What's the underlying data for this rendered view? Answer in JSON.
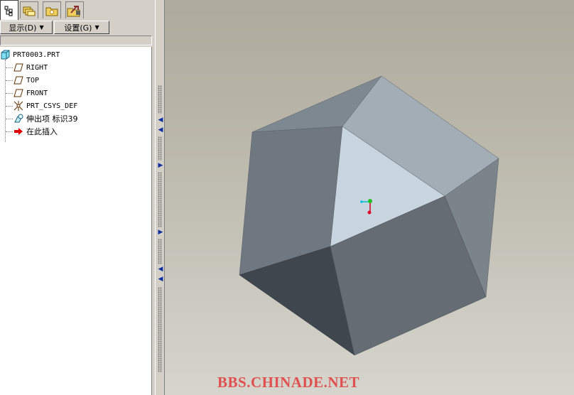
{
  "navigator": {
    "tabs": [
      {
        "icon": "model-tree-icon",
        "active": true
      },
      {
        "icon": "folder-browser-icon",
        "active": false
      },
      {
        "icon": "favorites-icon",
        "active": false
      },
      {
        "icon": "connections-icon",
        "active": false
      }
    ]
  },
  "menu": {
    "display_label": "显示(D)",
    "settings_label": "设置(G)"
  },
  "model_tree": {
    "root": "PRT0003.PRT",
    "items": [
      {
        "label": "RIGHT",
        "icon": "datum-plane-icon"
      },
      {
        "label": "TOP",
        "icon": "datum-plane-icon"
      },
      {
        "label": "FRONT",
        "icon": "datum-plane-icon"
      },
      {
        "label": "PRT_CSYS_DEF",
        "icon": "coordinate-system-icon"
      },
      {
        "label": "伸出项 标识39",
        "icon": "protrusion-icon"
      },
      {
        "label": "在此插入",
        "icon": "insert-here-arrow-icon"
      }
    ]
  },
  "watermark": "BBS.CHINADE.NET"
}
